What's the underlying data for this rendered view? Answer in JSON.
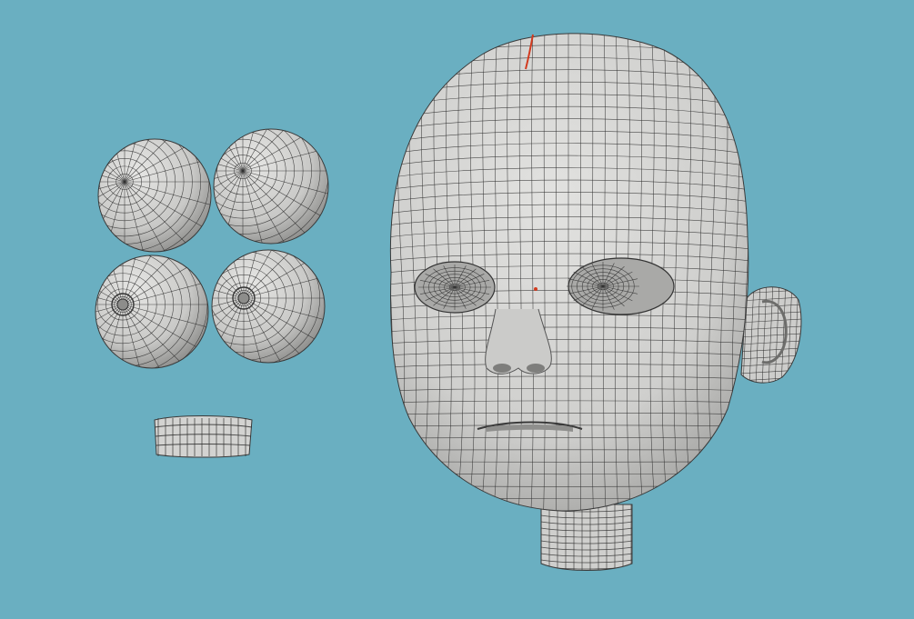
{
  "scene": {
    "background_color": "#6aafc1",
    "mesh_color": "#d6d6d4",
    "mesh_shadow": "#9c9c9a",
    "wire_color": "#2f2f2f",
    "seam_color": "#d23a1e"
  },
  "objects": {
    "eyeballs": [
      "eyeball-front",
      "eyeball-front",
      "eyeball-iris",
      "eyeball-iris"
    ],
    "teeth": "teeth",
    "head": "head",
    "neck": "neck",
    "ear": "ear"
  }
}
